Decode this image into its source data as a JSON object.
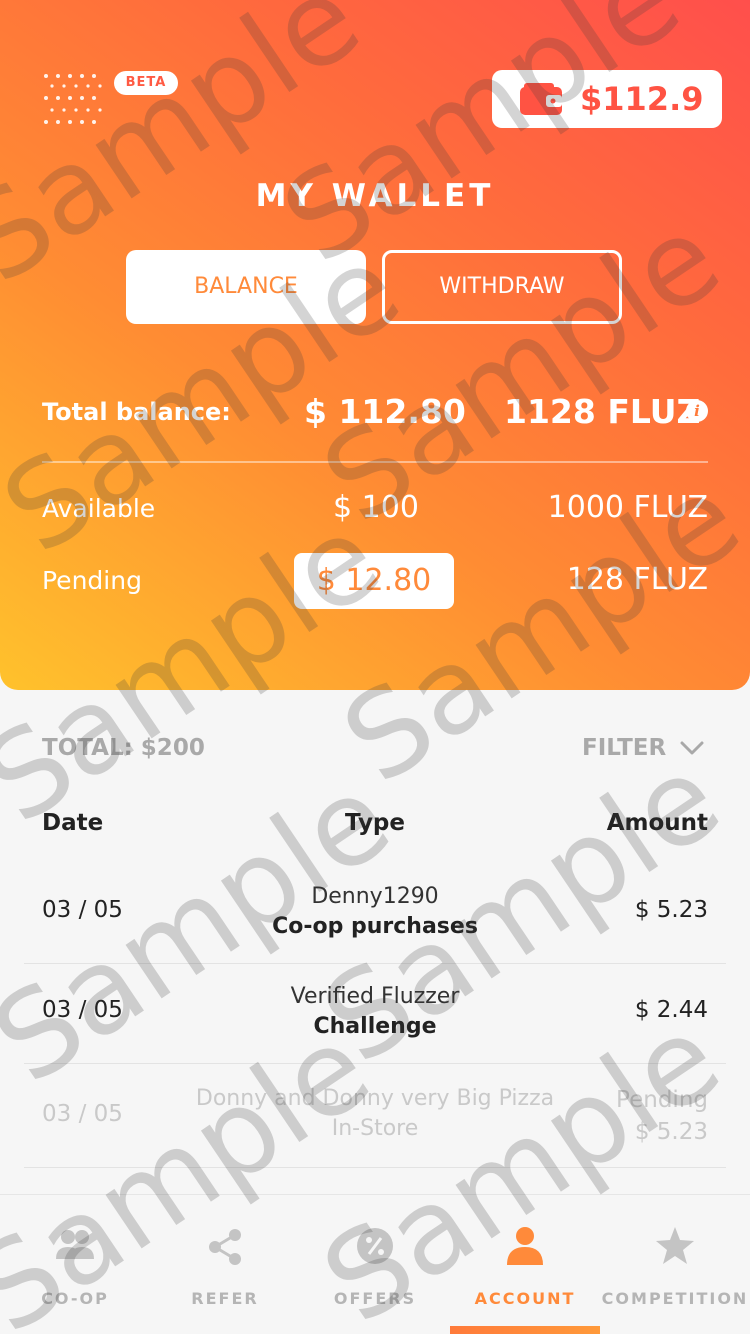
{
  "header": {
    "beta_label": "BETA",
    "wallet_amount": "$112.9",
    "title": "MY WALLET"
  },
  "tabs": {
    "balance": "BALANCE",
    "withdraw": "WITHDRAW"
  },
  "summary": {
    "total_label": "Total balance:",
    "total_value": "$ 112.80",
    "total_fluz": "1128 FLUZ",
    "available_label": "Available",
    "available_value": "$ 100",
    "available_fluz": "1000 FLUZ",
    "pending_label": "Pending",
    "pending_value": "$ 12.80",
    "pending_fluz": "128 FLUZ"
  },
  "list": {
    "total": "TOTAL: $200",
    "filter_label": "FILTER",
    "headers": {
      "date": "Date",
      "type": "Type",
      "amount": "Amount"
    },
    "rows": [
      {
        "date": "03 / 05",
        "name": "Denny1290",
        "kind": "Co-op purchases",
        "amount": "$ 5.23"
      },
      {
        "date": "03 / 05",
        "name": "Verified Fluzzer",
        "kind": "Challenge",
        "amount": "$ 2.44"
      },
      {
        "date": "03 / 05",
        "name": "Donny and Donny very Big Pizza",
        "kind": "In-Store",
        "status": "Pending",
        "amount": "$ 5.23"
      }
    ]
  },
  "nav": {
    "items": [
      {
        "label": "CO-OP",
        "icon": "people-icon"
      },
      {
        "label": "REFER",
        "icon": "share-icon"
      },
      {
        "label": "OFFERS",
        "icon": "percent-badge-icon"
      },
      {
        "label": "ACCOUNT",
        "icon": "person-icon"
      },
      {
        "label": "COMPETITION",
        "icon": "star-icon"
      }
    ],
    "active": "ACCOUNT"
  },
  "watermark_text": "Sample",
  "colors": {
    "accent": "#ff8a3a",
    "accent_red": "#ff5343",
    "gradient_top": "#ff4f4c",
    "gradient_bottom": "#ffc22c",
    "muted": "#b5b5b5"
  }
}
